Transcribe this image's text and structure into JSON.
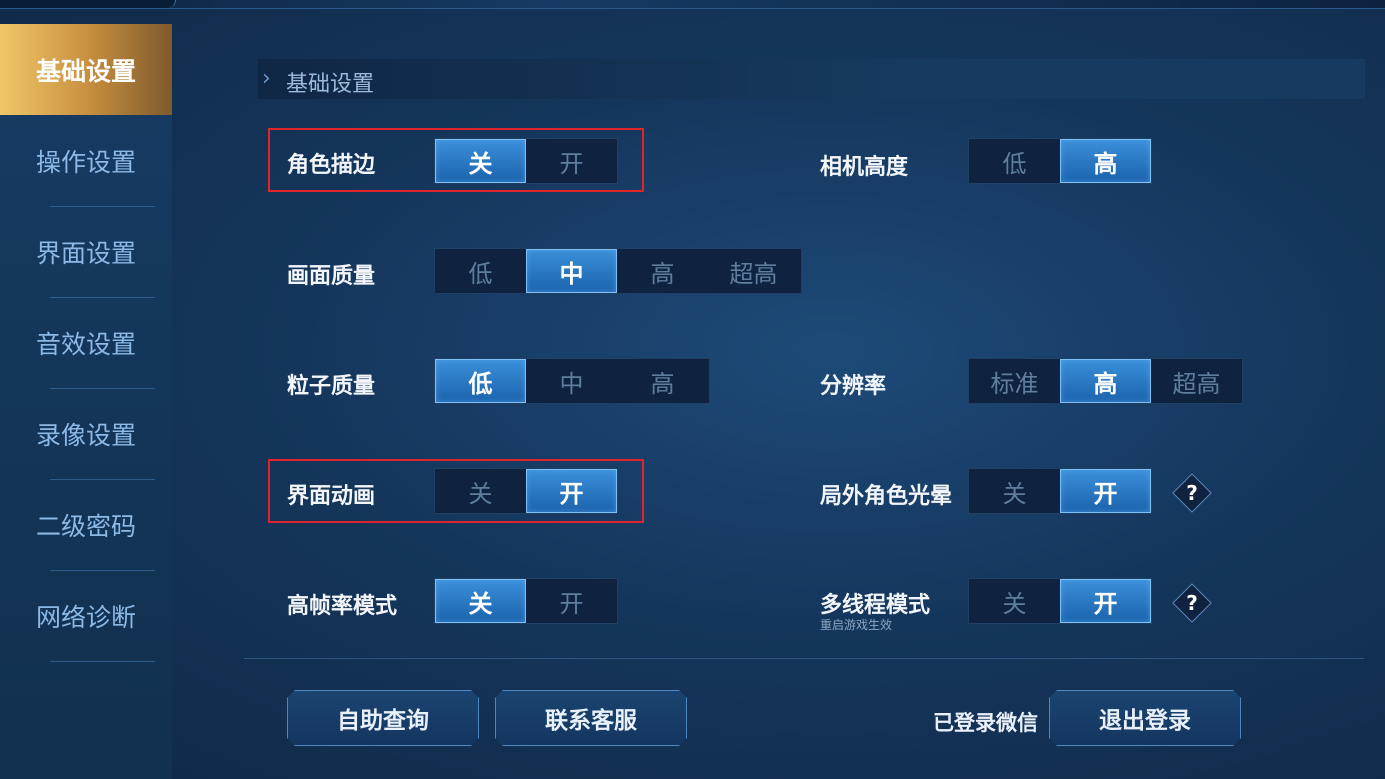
{
  "sidebar": {
    "items": [
      {
        "label": "基础设置",
        "active": true
      },
      {
        "label": "操作设置",
        "active": false
      },
      {
        "label": "界面设置",
        "active": false
      },
      {
        "label": "音效设置",
        "active": false
      },
      {
        "label": "录像设置",
        "active": false
      },
      {
        "label": "二级密码",
        "active": false
      },
      {
        "label": "网络诊断",
        "active": false
      }
    ]
  },
  "section": {
    "title": "基础设置"
  },
  "settings": {
    "outline": {
      "label": "角色描边",
      "options": [
        "关",
        "开"
      ],
      "selected": "关"
    },
    "camera_height": {
      "label": "相机高度",
      "options": [
        "低",
        "高"
      ],
      "selected": "高"
    },
    "graphics_quality": {
      "label": "画面质量",
      "options": [
        "低",
        "中",
        "高",
        "超高"
      ],
      "selected": "中"
    },
    "particle_quality": {
      "label": "粒子质量",
      "options": [
        "低",
        "中",
        "高"
      ],
      "selected": "低"
    },
    "resolution": {
      "label": "分辨率",
      "options": [
        "标准",
        "高",
        "超高"
      ],
      "selected": "高"
    },
    "ui_animation": {
      "label": "界面动画",
      "options": [
        "关",
        "开"
      ],
      "selected": "开"
    },
    "outside_halo": {
      "label": "局外角色光晕",
      "options": [
        "关",
        "开"
      ],
      "selected": "开"
    },
    "high_fps": {
      "label": "高帧率模式",
      "options": [
        "关",
        "开"
      ],
      "selected": "关"
    },
    "multithread": {
      "label": "多线程模式",
      "note": "重启游戏生效",
      "options": [
        "关",
        "开"
      ],
      "selected": "开"
    }
  },
  "help_icon": "?",
  "footer": {
    "self_help": "自助查询",
    "contact": "联系客服",
    "logged_in": "已登录微信",
    "logout": "退出登录"
  },
  "colors": {
    "highlight_box": "#e0242e",
    "selected": "#2a7ac8",
    "active_tab": "#c99140"
  }
}
